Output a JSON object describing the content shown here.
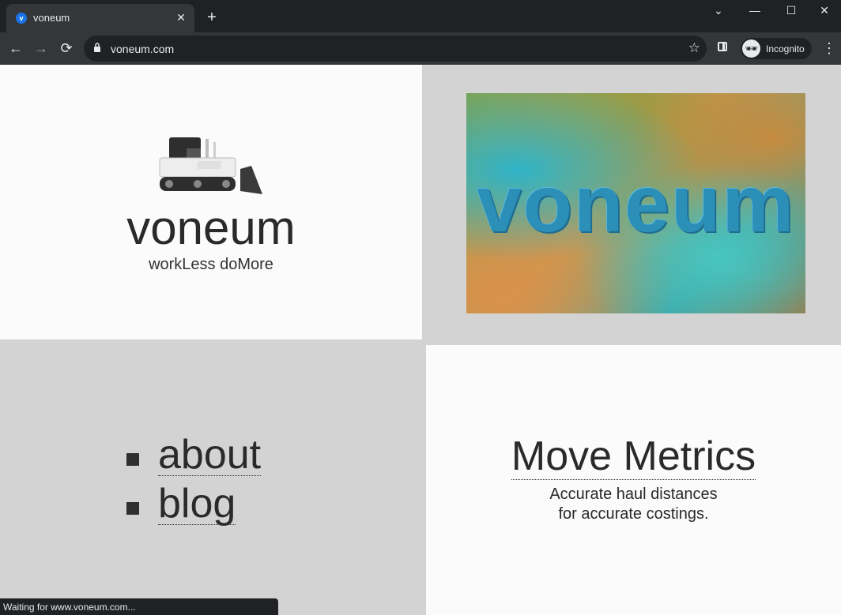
{
  "browser": {
    "tab": {
      "favicon_letter": "v",
      "title": "voneum",
      "close_glyph": "✕"
    },
    "new_tab_glyph": "+",
    "window_controls": {
      "tab_search": "⌄",
      "minimize": "—",
      "maximize": "☐",
      "close": "✕"
    },
    "nav": {
      "back": "←",
      "forward": "→",
      "reload": "⟳"
    },
    "address": {
      "url": "voneum.com",
      "bookmark_glyph": "☆"
    },
    "profile": {
      "label": "Incognito",
      "avatar_glyph": "🕶"
    },
    "menu_glyph": "⋮",
    "status_text": "Waiting for www.voneum.com..."
  },
  "page": {
    "brand": "voneum",
    "tagline": "workLess doMore",
    "banner_text": "voneum",
    "nav_links": [
      {
        "label": "about"
      },
      {
        "label": "blog"
      }
    ],
    "feature": {
      "title": "Move Metrics",
      "desc_line1": "Accurate haul distances",
      "desc_line2": "for accurate costings."
    }
  },
  "colors": {
    "chrome_dark": "#202124",
    "chrome_toolbar": "#35363a",
    "panel_light": "#fbfbfb",
    "panel_gray": "#d3d3d3",
    "banner_text": "#2b8fb8"
  }
}
